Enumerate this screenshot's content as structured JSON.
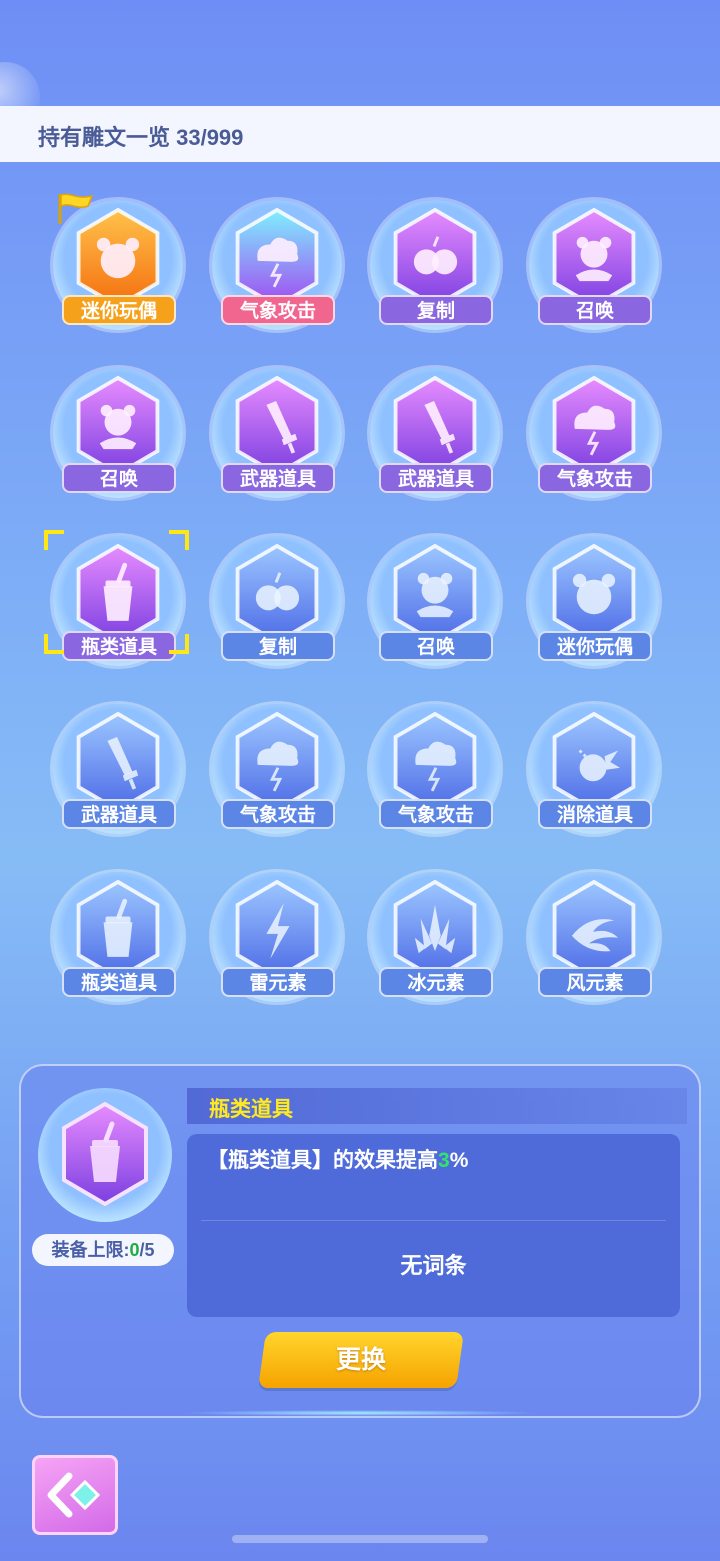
{
  "header": {
    "title": "持有雕文一览 33/999"
  },
  "colors": {
    "orange": "#f6a11b",
    "pink": "#f0668f",
    "purple": "#8a66e0",
    "blue": "#5c86e6",
    "highlight_green": "#31e36d",
    "selection_yellow": "#ffe617"
  },
  "runes": [
    {
      "label": "迷你玩偶",
      "tier": "orange",
      "icon": "bear-icon",
      "flag": true
    },
    {
      "label": "气象攻击",
      "tier": "pink",
      "icon": "storm-cloud-icon"
    },
    {
      "label": "复制",
      "tier": "purple",
      "icon": "apples-icon"
    },
    {
      "label": "召唤",
      "tier": "purple",
      "icon": "summon-bear-icon"
    },
    {
      "label": "召唤",
      "tier": "purple",
      "icon": "summon-bear-icon"
    },
    {
      "label": "武器道具",
      "tier": "purple",
      "icon": "sword-icon"
    },
    {
      "label": "武器道具",
      "tier": "purple",
      "icon": "sword-icon"
    },
    {
      "label": "气象攻击",
      "tier": "purple",
      "icon": "storm-cloud-icon"
    },
    {
      "label": "瓶类道具",
      "tier": "purple",
      "icon": "bottle-icon",
      "selected": true
    },
    {
      "label": "复制",
      "tier": "blue",
      "icon": "apples-icon"
    },
    {
      "label": "召唤",
      "tier": "blue",
      "icon": "summon-bear-icon"
    },
    {
      "label": "迷你玩偶",
      "tier": "blue",
      "icon": "bear-icon"
    },
    {
      "label": "武器道具",
      "tier": "blue",
      "icon": "sword-icon"
    },
    {
      "label": "气象攻击",
      "tier": "blue",
      "icon": "storm-cloud-icon"
    },
    {
      "label": "气象攻击",
      "tier": "blue",
      "icon": "storm-cloud-icon"
    },
    {
      "label": "消除道具",
      "tier": "blue",
      "icon": "bomb-icon"
    },
    {
      "label": "瓶类道具",
      "tier": "blue",
      "icon": "bottle-icon"
    },
    {
      "label": "雷元素",
      "tier": "blue",
      "icon": "lightning-icon"
    },
    {
      "label": "冰元素",
      "tier": "blue",
      "icon": "ice-crystal-icon"
    },
    {
      "label": "风元素",
      "tier": "blue",
      "icon": "wind-icon"
    }
  ],
  "detail": {
    "title": "瓶类道具",
    "icon": "bottle-icon",
    "limit_label": "装备上限:",
    "limit_value": "0",
    "limit_max": "/5",
    "effect_prefix": "【瓶类道具】的效果提高",
    "effect_value": "3",
    "effect_suffix": "%",
    "no_entry": "无词条",
    "change_button": "更换"
  }
}
